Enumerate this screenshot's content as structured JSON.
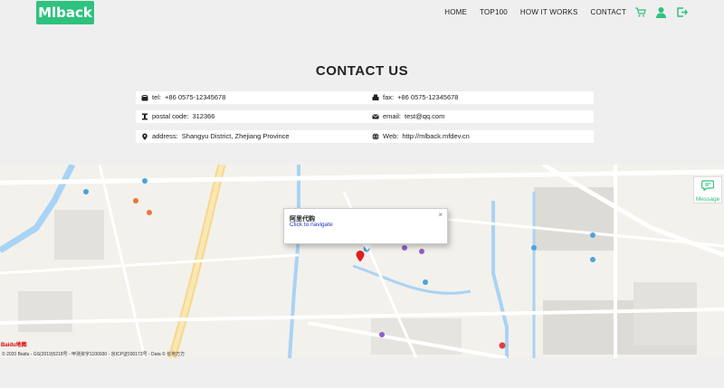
{
  "header": {
    "logo": "Mlback",
    "nav": [
      "HOME",
      "TOP100",
      "HOW IT WORKS",
      "CONTACT"
    ],
    "icons": [
      "cart-icon",
      "user-icon",
      "logout-icon"
    ],
    "accent_color": "#2ec27e"
  },
  "page_title": "CONTACT US",
  "contact": {
    "tel_label": "tel:",
    "tel_value": "+86 0575-12345678",
    "fax_label": "fax:",
    "fax_value": "+86 0575-12345678",
    "postal_label": "postal code:",
    "postal_value": "312366",
    "email_label": "email:",
    "email_value": "test@qq.com",
    "address_label": "address:",
    "address_value": "Shangyu District, Zhejiang Province",
    "web_label": "Web:",
    "web_value": "http://mlback.mfdev.cn"
  },
  "map": {
    "popup_title": "阿里代购",
    "popup_link": "Click to navigate",
    "popup_close": "×",
    "message_label": "Message",
    "baidu_logo": "Baidu地图",
    "copyright": "© 2020 Baidu - GS(2019)5218号 - 甲测资字1100930 - 京ICP证030173号 - Data © 长地万方"
  }
}
